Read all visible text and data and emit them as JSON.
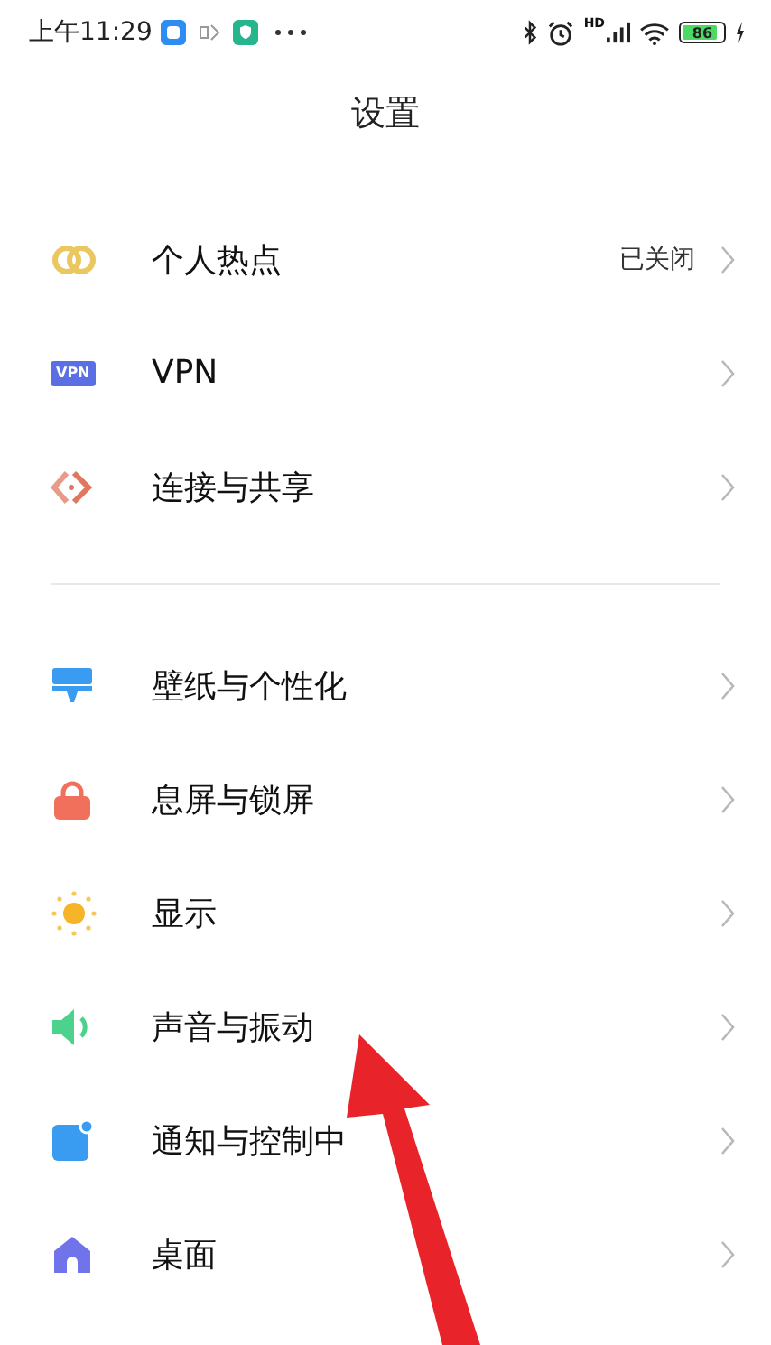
{
  "status_bar": {
    "time": "上午11:29",
    "network_badge": "HD",
    "battery": "86"
  },
  "title": "设置",
  "groups": [
    {
      "items": [
        {
          "label": "个人热点",
          "value": "已关闭"
        },
        {
          "label": "VPN",
          "icon_text": "VPN"
        },
        {
          "label": "连接与共享"
        }
      ]
    },
    {
      "items": [
        {
          "label": "壁纸与个性化"
        },
        {
          "label": "息屏与锁屏"
        },
        {
          "label": "显示"
        },
        {
          "label": "声音与振动"
        },
        {
          "label": "通知与控制中"
        },
        {
          "label": "桌面"
        }
      ]
    }
  ]
}
